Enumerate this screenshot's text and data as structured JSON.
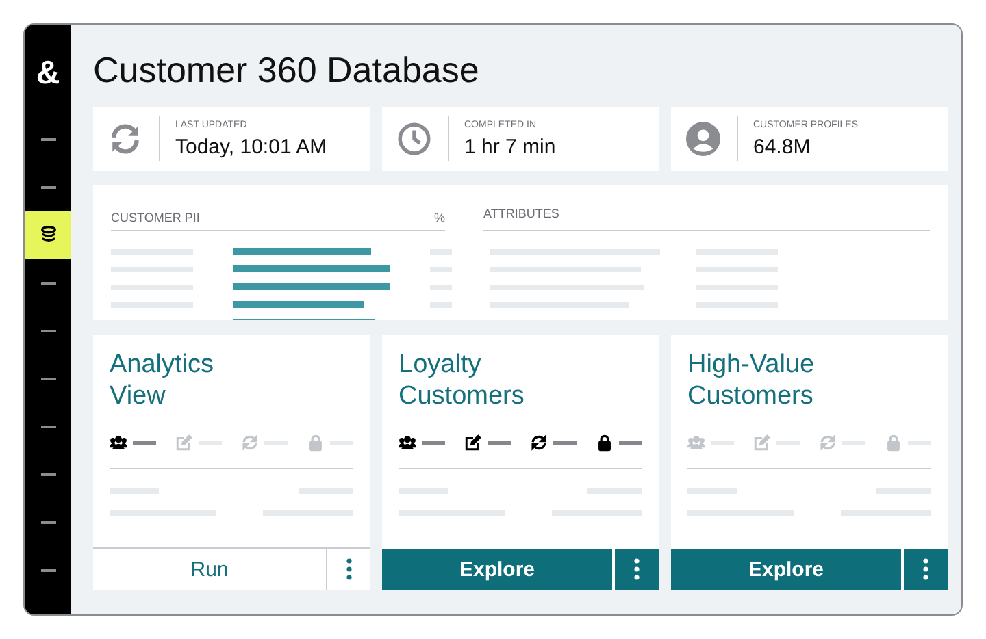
{
  "sidebar": {
    "logo": "&",
    "items": [
      {
        "kind": "dash",
        "selected": false
      },
      {
        "kind": "dash",
        "selected": false
      },
      {
        "kind": "database",
        "selected": true
      },
      {
        "kind": "dash",
        "selected": false
      },
      {
        "kind": "dash",
        "selected": false
      },
      {
        "kind": "dash",
        "selected": false
      },
      {
        "kind": "dash",
        "selected": false
      },
      {
        "kind": "dash",
        "selected": false
      },
      {
        "kind": "dash",
        "selected": false
      },
      {
        "kind": "dash",
        "selected": false
      }
    ]
  },
  "title": "Customer 360 Database",
  "stats": [
    {
      "label": "LAST UPDATED",
      "value": "Today, 10:01 AM"
    },
    {
      "label": "COMPLETED IN",
      "value": "1 hr 7 min"
    },
    {
      "label": "CUSTOMER PROFILES",
      "value": "64.8M"
    }
  ],
  "table": {
    "columns": [
      "CUSTOMER PII",
      "%",
      "ATTRIBUTES"
    ],
    "rows": [
      {
        "level": 0.84
      },
      {
        "level": 0.96
      },
      {
        "level": 0.96
      },
      {
        "level": 0.8
      },
      {
        "level": 0.87
      }
    ]
  },
  "cards": [
    {
      "title": "Analytics View",
      "icons": [
        {
          "kind": "people",
          "on": true
        },
        {
          "kind": "edit",
          "on": false
        },
        {
          "kind": "refresh",
          "on": false
        },
        {
          "kind": "lock",
          "on": false
        }
      ],
      "button": {
        "label": "Run",
        "kind": "outline"
      }
    },
    {
      "title": "Loyalty Customers",
      "icons": [
        {
          "kind": "people",
          "on": true
        },
        {
          "kind": "edit",
          "on": true
        },
        {
          "kind": "refresh",
          "on": true
        },
        {
          "kind": "lock",
          "on": true
        }
      ],
      "button": {
        "label": "Explore",
        "kind": "filled"
      }
    },
    {
      "title": "High-Value Customers",
      "icons": [
        {
          "kind": "people",
          "on": false
        },
        {
          "kind": "edit",
          "on": false
        },
        {
          "kind": "refresh",
          "on": false
        },
        {
          "kind": "lock",
          "on": false
        }
      ],
      "button": {
        "label": "Explore",
        "kind": "filled"
      }
    }
  ]
}
